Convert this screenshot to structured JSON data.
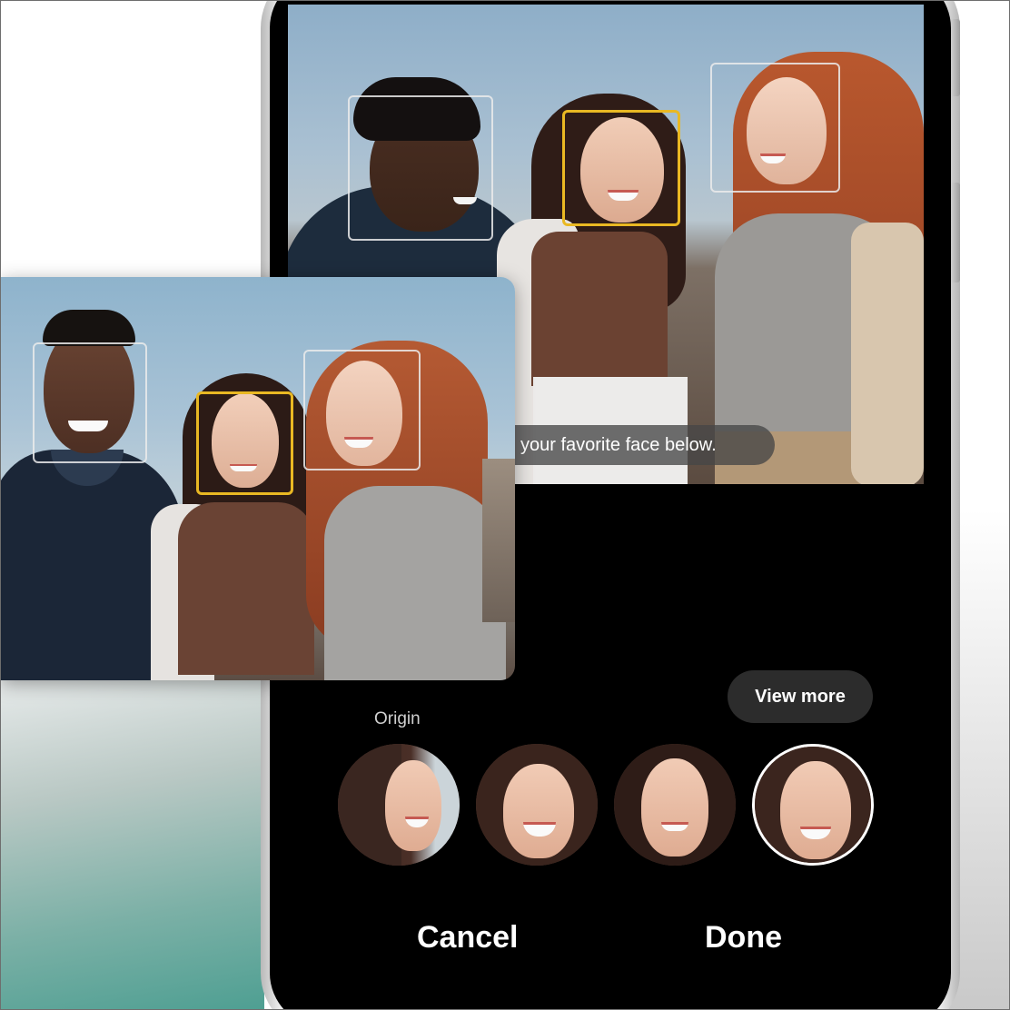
{
  "hint": {
    "text": "your favorite face below."
  },
  "controls": {
    "view_more_label": "View more",
    "origin_label": "Origin",
    "cancel_label": "Cancel",
    "done_label": "Done"
  },
  "faces": {
    "main_selected_index": 1,
    "thumbnail_selected_index": 3
  },
  "colors": {
    "selection_frame": "#e9b823",
    "face_frame": "#ebebeb",
    "screen_background": "#000000",
    "pill_background": "#2c2c2c"
  }
}
